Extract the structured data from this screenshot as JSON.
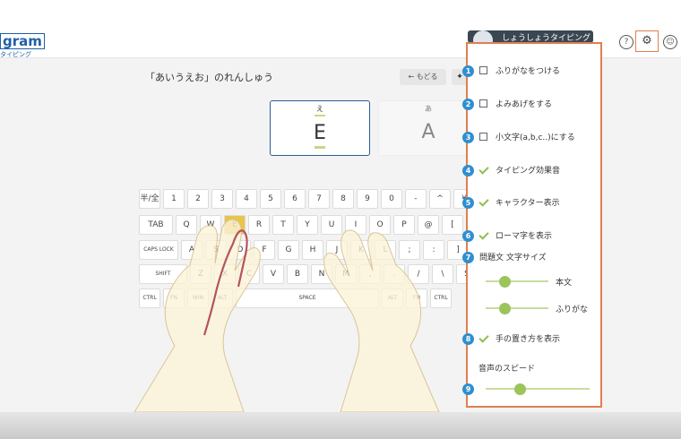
{
  "header": {
    "logo_text": "gram",
    "logo_sub": "タイピング",
    "user_name": "しょうしょうタイピング",
    "help_icon": "question-circle-icon",
    "settings_icon": "gear-icon",
    "account_icon": "user-circle-icon"
  },
  "lesson": {
    "title": "「あいうえお」のれんしゅう",
    "back_label": "← もどる",
    "hint_icon": "lightbulb-icon"
  },
  "cards": {
    "current": {
      "kana": "え",
      "romaji": "E"
    },
    "next": {
      "kana": "あ",
      "romaji": "A"
    }
  },
  "keyboard": {
    "rows": [
      [
        "半/全",
        "1",
        "2",
        "3",
        "4",
        "5",
        "6",
        "7",
        "8",
        "9",
        "0",
        "-",
        "^",
        "¥"
      ],
      [
        "TAB",
        "Q",
        "W",
        "E",
        "R",
        "T",
        "Y",
        "U",
        "I",
        "O",
        "P",
        "@",
        "["
      ],
      [
        "CAPS LOCK",
        "A",
        "S",
        "D",
        "F",
        "G",
        "H",
        "J",
        "K",
        "L",
        ";",
        ":",
        "]"
      ],
      [
        "SHIFT",
        "Z",
        "X",
        "C",
        "V",
        "B",
        "N",
        "M",
        ",",
        ".",
        "/",
        "\\",
        "S"
      ],
      [
        "CTRL",
        "FN",
        "WIN",
        "ALT",
        "SPACE",
        "ALT",
        "FN",
        "CTRL"
      ]
    ],
    "highlight": "E",
    "highlight_color": "#e9c44a"
  },
  "settings": {
    "items": [
      {
        "num": "1",
        "label": "ふりがなをつける",
        "checked": false
      },
      {
        "num": "2",
        "label": "よみあげをする",
        "checked": false
      },
      {
        "num": "3",
        "label": "小文字(a,b,c..)にする",
        "checked": false
      },
      {
        "num": "4",
        "label": "タイピング効果音",
        "checked": true
      },
      {
        "num": "5",
        "label": "キャラクター表示",
        "checked": true
      },
      {
        "num": "6",
        "label": "ローマ字を表示",
        "checked": true
      }
    ],
    "size_section": {
      "num": "7",
      "label": "問題文 文字サイズ",
      "main_label": "本文",
      "main_value": 0.3,
      "furigana_label": "ふりがな",
      "furigana_value": 0.3
    },
    "hands": {
      "num": "8",
      "label": "手の置き方を表示",
      "checked": true
    },
    "speed_section": {
      "num": "9",
      "label": "音声のスピード",
      "value": 0.33
    },
    "accent_color": "#e07f4f",
    "badge_color": "#2f8fd0",
    "check_color": "#8cc04f"
  }
}
